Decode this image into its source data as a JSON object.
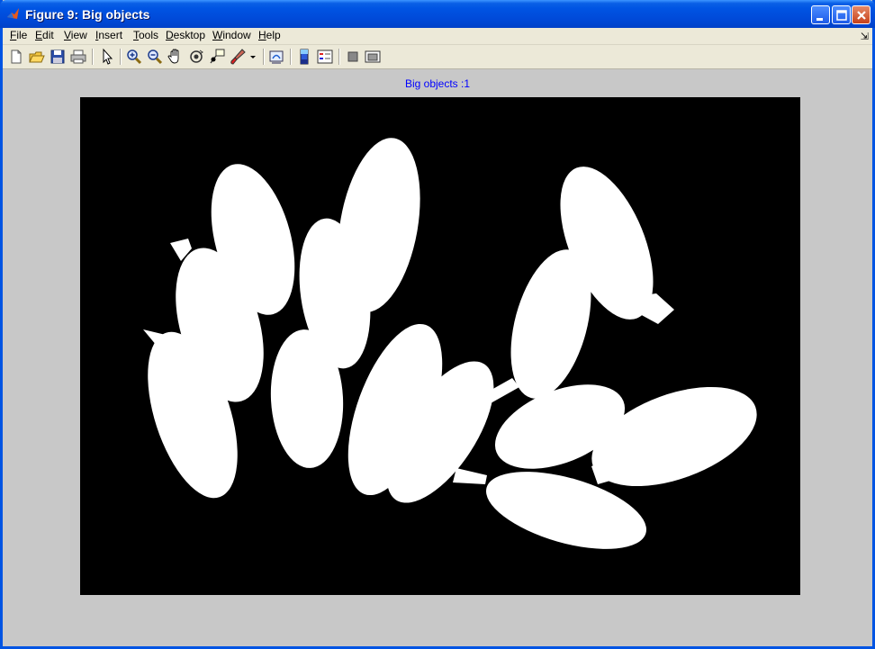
{
  "window": {
    "title": "Figure 9: Big objects",
    "app_icon": "matlab-icon"
  },
  "title_buttons": [
    {
      "name": "minimize-icon"
    },
    {
      "name": "maximize-icon"
    },
    {
      "name": "close-icon"
    }
  ],
  "menu": {
    "items": [
      {
        "acc": "F",
        "rest": "ile"
      },
      {
        "acc": "E",
        "rest": "dit"
      },
      {
        "acc": "V",
        "rest": "iew"
      },
      {
        "acc": "I",
        "rest": "nsert"
      },
      {
        "acc": "T",
        "rest": "ools"
      },
      {
        "acc": "D",
        "rest": "esktop"
      },
      {
        "acc": "W",
        "rest": "indow"
      },
      {
        "acc": "H",
        "rest": "elp"
      }
    ],
    "dock_icon": "dock-arrow-icon"
  },
  "toolbar": {
    "tools": [
      "new-figure-icon",
      "open-file-icon",
      "save-icon",
      "print-icon",
      "edit-plot-icon",
      "zoom-in-icon",
      "zoom-out-icon",
      "pan-icon",
      "rotate-3d-icon",
      "data-cursor-icon",
      "brush-icon",
      "link-plot-icon",
      "insert-colorbar-icon",
      "insert-legend-icon",
      "hide-plot-tools-icon",
      "show-plot-tools-icon"
    ]
  },
  "axes": {
    "title": "Big objects :1",
    "background": "#000000",
    "foreground": "#ffffff",
    "title_color": "#0000ff"
  },
  "colors": {
    "titlebar": "#0054e3",
    "menubar": "#ece9d8",
    "figure_bg": "#c8c8c8"
  }
}
